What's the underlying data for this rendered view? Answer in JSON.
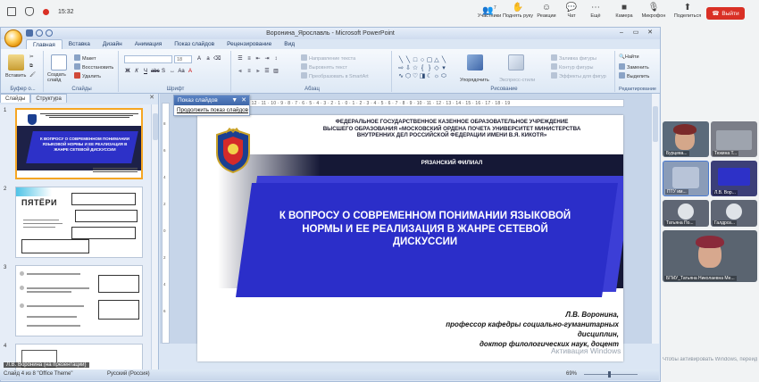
{
  "callbar": {
    "tools": [
      "Участники",
      "Поднять руку",
      "Реакции",
      "Чат",
      "Ещё",
      "Камера",
      "Микрофон",
      "Поделиться"
    ],
    "exit_label": "Выйти",
    "time": "15:32",
    "participants_count": "7"
  },
  "window": {
    "title": "Воронина_Ярославль - Microsoft PowerPoint"
  },
  "ribbon": {
    "tabs": [
      "Главная",
      "Вставка",
      "Дизайн",
      "Анимация",
      "Показ слайдов",
      "Рецензирование",
      "Вид"
    ],
    "groups": {
      "clipboard": "Буфер о...",
      "slides": "Слайды",
      "font": "Шрифт",
      "paragraph": "Абзац",
      "drawing": "Рисование",
      "editing": "Редактирование"
    },
    "buttons": {
      "paste": "Вставить",
      "create_slide": "Создать слайд",
      "layout": "Макет",
      "reset": "Восстановить",
      "delete": "Удалить",
      "text_direction": "Направление текста",
      "align_text": "Выровнять текст",
      "smartart": "Преобразовать в SmartArt",
      "arrange": "Упорядочить",
      "quick_styles": "Экспресс-стили",
      "shape_fill": "Заливка фигуры",
      "shape_outline": "Контур фигуры",
      "shape_effects": "Эффекты для фигур",
      "find": "Найти",
      "replace": "Заменить",
      "select": "Выделить",
      "font_size": "18"
    }
  },
  "left_pane": {
    "tabs": [
      "Слайды",
      "Структура"
    ],
    "slide_numbers": [
      "1",
      "2",
      "3",
      "4"
    ],
    "thumb1_title": "К ВОПРОСУ О СОВРЕМЕННОМ ПОНИМАНИИ ЯЗЫКОВОЙ НОРМЫ И ЕЕ РЕАЛИЗАЦИЯ В ЖАНРЕ СЕТЕВОЙ ДИСКУССИИ",
    "thumb2_logo": "ПЯТЁРИ"
  },
  "popup": {
    "title": "Показ слайдов",
    "link": "Продолжить показ слайдов"
  },
  "slide": {
    "header": "ФЕДЕРАЛЬНОЕ ГОСУДАРСТВЕННОЕ КАЗЕННОЕ ОБРАЗОВАТЕЛЬНОЕ УЧРЕЖДЕНИЕ ВЫСШЕГО ОБРАЗОВАНИЯ «МОСКОВСКИЙ ОРДЕНА ПОЧЕТА УНИВЕРСИТЕТ МИНИСТЕРСТВА ВНУТРЕННИХ ДЕЛ РОССИЙСКОЙ ФЕДЕРАЦИИ ИМЕНИ В.Я. КИКОТЯ»",
    "branch": "РЯЗАНСКИЙ ФИЛИАЛ",
    "title": "К ВОПРОСУ О СОВРЕМЕННОМ ПОНИМАНИИ ЯЗЫКОВОЙ НОРМЫ И ЕЕ РЕАЛИЗАЦИЯ В ЖАНРЕ СЕТЕВОЙ ДИСКУССИИ",
    "author_name": "Л.В. Воронина,",
    "author_role": "профессор кафедры социально-гуманитарных дисциплин,",
    "author_degree": "доктор филологических наук, доцент"
  },
  "status": {
    "slide_info": "Слайд 4 из 8   \"Office Theme\"",
    "language": "Русский (Россия)",
    "zoom": "69%",
    "zoom_level": 0.45
  },
  "overlay": {
    "speaker_label": "Л.В. Воронина (на презентации)",
    "activation_watermark": "Активация Windows",
    "activation_hint": "Чтобы активировать Windows, перейдите в раздел \"Параметры\"."
  },
  "participants": [
    {
      "name": "Бурцева..."
    },
    {
      "name": "Тюкина Т..."
    },
    {
      "name": "ПТУ им..."
    },
    {
      "name": "Л.В. Вор..."
    },
    {
      "name": "Татьяна По..."
    },
    {
      "name": "Галдроз..."
    },
    {
      "name": "БГМУ_Татьяна Николаевна Ме..."
    }
  ]
}
